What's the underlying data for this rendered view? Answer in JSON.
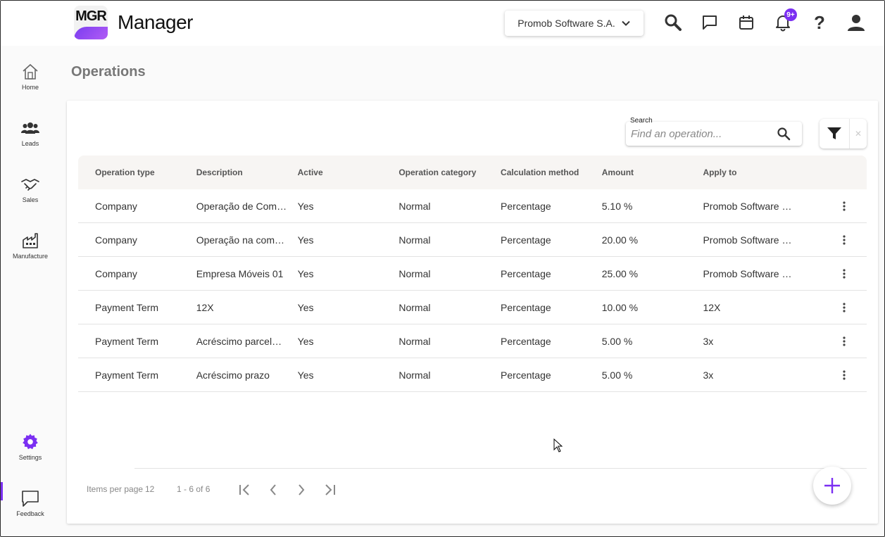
{
  "header": {
    "logo_text": "MGR",
    "app_title": "Manager",
    "company": "Promob Software S.A.",
    "notifications_badge": "9+"
  },
  "sidebar": {
    "items": [
      {
        "label": "Home",
        "icon": "home-icon"
      },
      {
        "label": "Leads",
        "icon": "people-icon"
      },
      {
        "label": "Sales",
        "icon": "handshake-icon"
      },
      {
        "label": "Manufacture",
        "icon": "factory-icon"
      },
      {
        "label": "Settings",
        "icon": "gear-icon"
      },
      {
        "label": "Feedback",
        "icon": "chat-icon"
      }
    ],
    "accent": "#7b2ff2"
  },
  "page": {
    "title": "Operations"
  },
  "search": {
    "label": "Search",
    "placeholder": "Find an operation..."
  },
  "table": {
    "columns": [
      "Operation type",
      "Description",
      "Active",
      "Operation category",
      "Calculation method",
      "Amount",
      "Apply to"
    ],
    "rows": [
      [
        "Company",
        "Operação de Com…",
        "Yes",
        "Normal",
        "Percentage",
        "5.10 %",
        "Promob Software …"
      ],
      [
        "Company",
        "Operação na com…",
        "Yes",
        "Normal",
        "Percentage",
        "20.00 %",
        "Promob Software …"
      ],
      [
        "Company",
        "Empresa Móveis 01",
        "Yes",
        "Normal",
        "Percentage",
        "25.00 %",
        "Promob Software …"
      ],
      [
        "Payment Term",
        "12X",
        "Yes",
        "Normal",
        "Percentage",
        "10.00 %",
        "12X"
      ],
      [
        "Payment Term",
        "Acréscimo parcel…",
        "Yes",
        "Normal",
        "Percentage",
        "5.00 %",
        "3x"
      ],
      [
        "Payment Term",
        "Acréscimo prazo",
        "Yes",
        "Normal",
        "Percentage",
        "5.00 %",
        "3x"
      ]
    ]
  },
  "pager": {
    "items_per_page_label": "Items per page",
    "items_per_page": "12",
    "range": "1 - 6 of 6"
  }
}
